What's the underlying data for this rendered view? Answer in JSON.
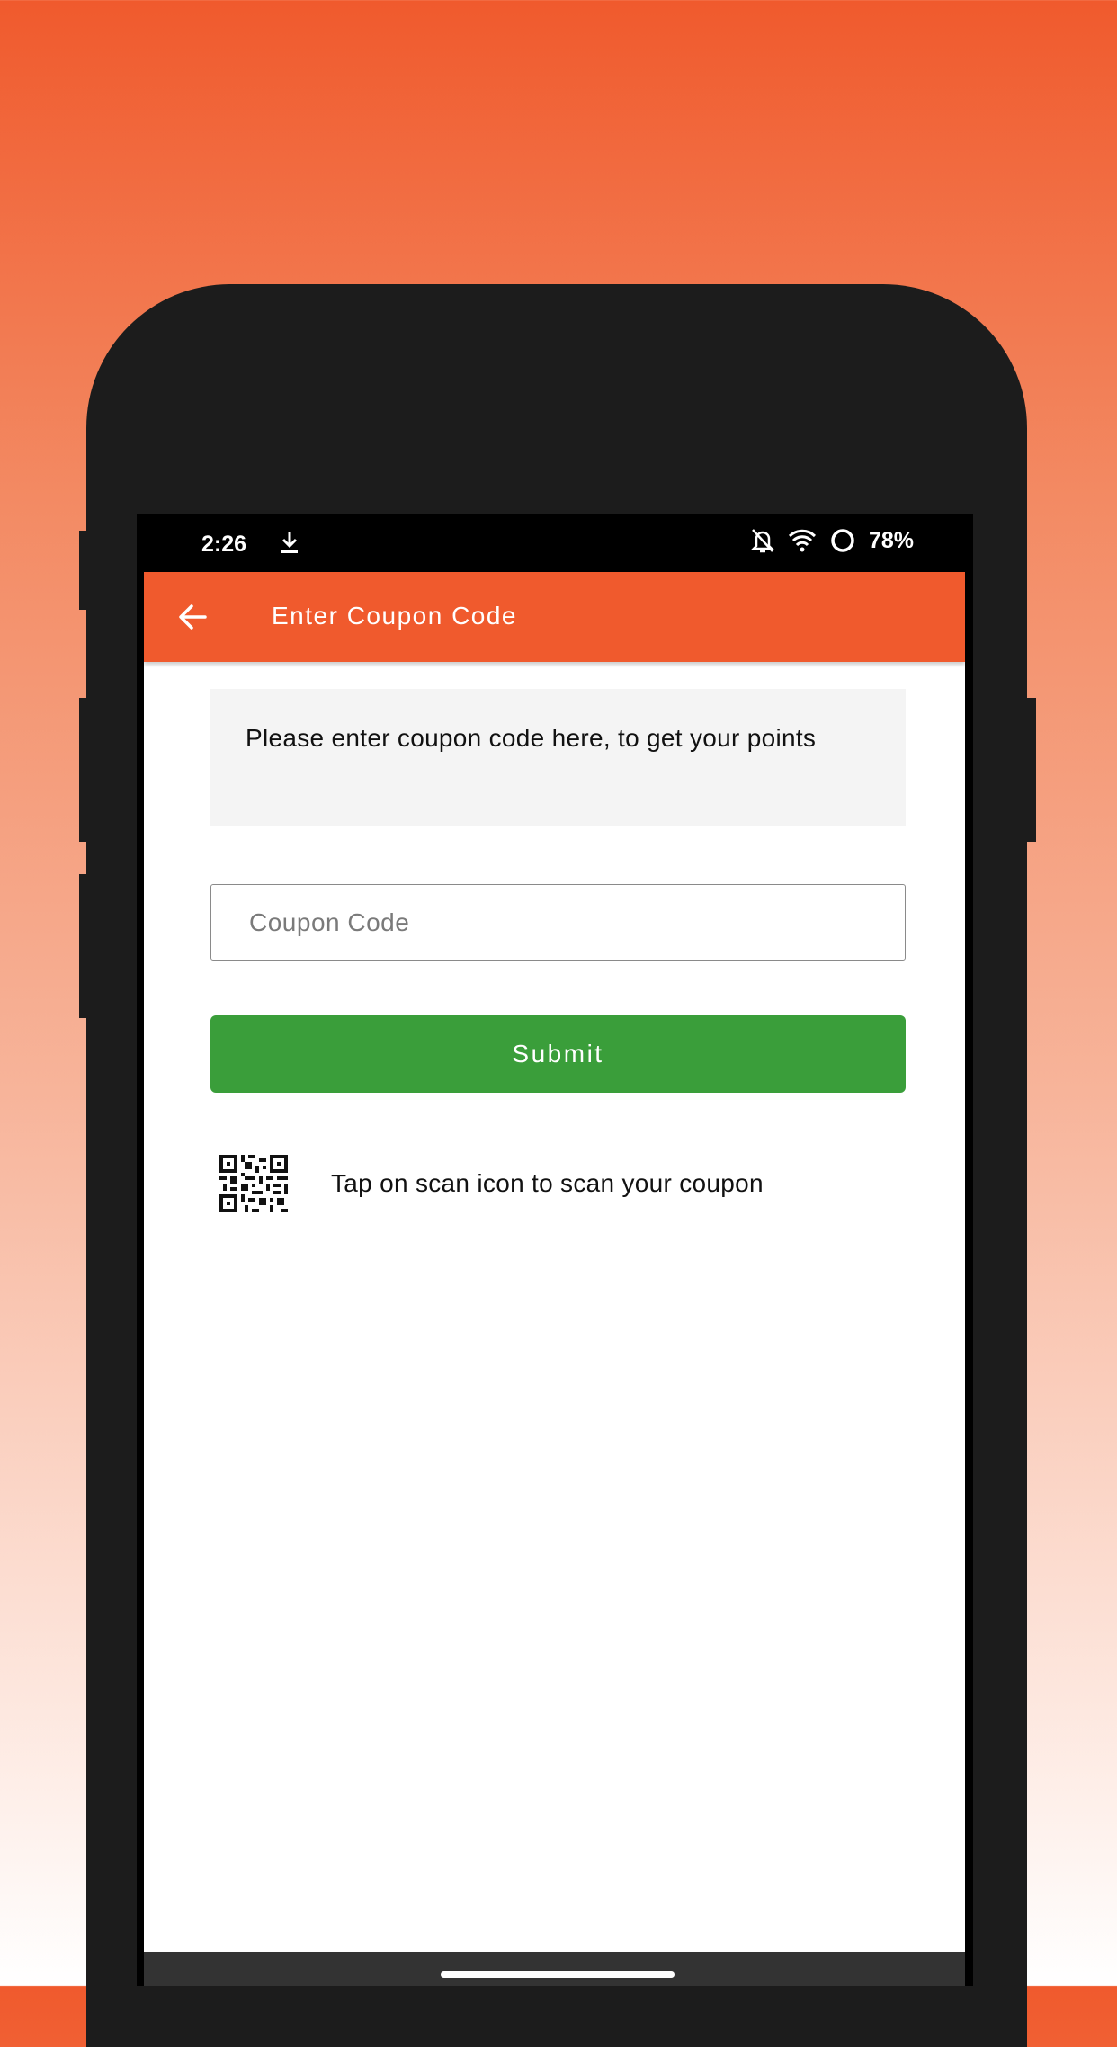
{
  "status_bar": {
    "time": "2:26",
    "battery": "78%",
    "icons": [
      "download-icon",
      "notifications-off-icon",
      "wifi-icon",
      "data-saver-icon"
    ]
  },
  "app_bar": {
    "title": "Enter Coupon Code",
    "back_icon": "arrow-left-icon",
    "color": "#f05a2d"
  },
  "info": {
    "message": "Please enter coupon code here, to get your points"
  },
  "coupon_input": {
    "placeholder": "Coupon Code",
    "value": ""
  },
  "submit": {
    "label": "Submit",
    "color": "#3a9e3a"
  },
  "scan": {
    "icon": "qr-code-icon",
    "text": "Tap on scan icon to scan your coupon"
  }
}
